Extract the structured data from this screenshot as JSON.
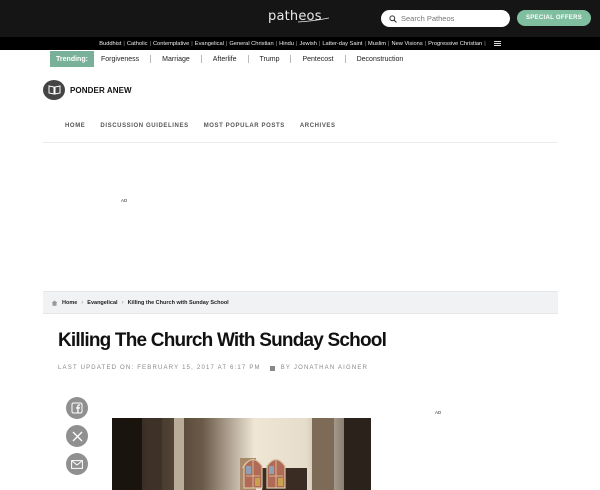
{
  "header": {
    "logo_text": "patheos",
    "search_placeholder": "Search Patheos",
    "special_offers_label": "SPECIAL OFFERS"
  },
  "categories": [
    "Buddhist",
    "Catholic",
    "Contemplative",
    "Evangelical",
    "General Christian",
    "Hindu",
    "Jewish",
    "Latter-day Saint",
    "Muslim",
    "New Visions",
    "Progressive Christian"
  ],
  "trending": {
    "label": "Trending:",
    "items": [
      "Forgiveness",
      "Marriage",
      "Afterlife",
      "Trump",
      "Pentecost",
      "Deconstruction"
    ]
  },
  "blog": {
    "name": "PONDER ANEW"
  },
  "nav": [
    "HOME",
    "DISCUSSION GUIDELINES",
    "MOST POPULAR POSTS",
    "ARCHIVES"
  ],
  "ads": {
    "top_label": "AD",
    "side_label": "AD"
  },
  "breadcrumb": [
    "Home",
    "Evangelical",
    "Killing the Church with Sunday School"
  ],
  "article": {
    "title": "Killing The Church With Sunday School",
    "updated": "LAST UPDATED ON: FEBRUARY 15, 2017 AT 6:17 PM",
    "author": "BY JONATHAN AIGNER"
  },
  "share": [
    "facebook-icon",
    "x-icon",
    "email-icon"
  ],
  "colors": {
    "accent": "#7fbfa0",
    "topbar": "#151515",
    "trending": "#79b09a"
  }
}
